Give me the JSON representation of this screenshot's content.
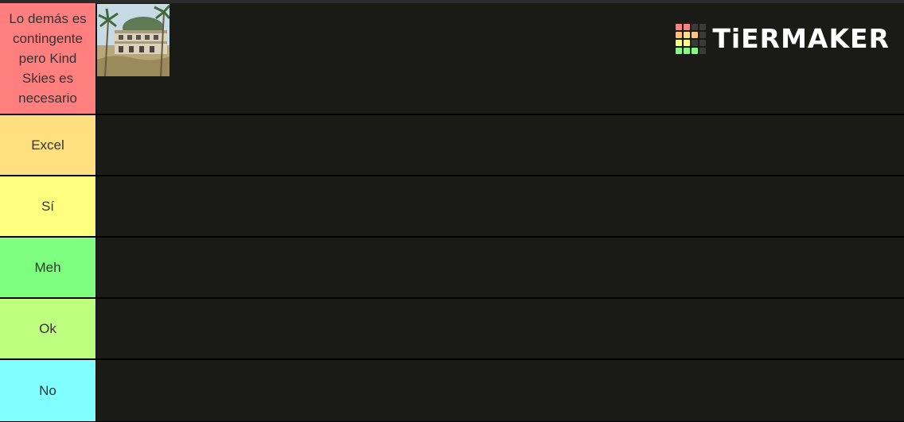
{
  "brand": {
    "name": "TiERMAKER",
    "grid_colors": [
      "#ff7f7f",
      "#ff7f7f",
      "#3a3a3a",
      "#3a3a3a",
      "#ffbf7f",
      "#ffdf7f",
      "#ffbf7f",
      "#3a3a3a",
      "#ffff7f",
      "#ffff7f",
      "#3a3a3a",
      "#3a3a3a",
      "#7fff7f",
      "#7fff7f",
      "#7fff7f",
      "#3a3a3a"
    ]
  },
  "tiers": [
    {
      "label": "Lo demás es contingente pero Kind Skies es necesario",
      "color": "#ff7f7f"
    },
    {
      "label": "Excel",
      "color": "#ffdf7f"
    },
    {
      "label": "Sí",
      "color": "#ffff7f"
    },
    {
      "label": "Meh",
      "color": "#7fff7f"
    },
    {
      "label": "Ok",
      "color": "#bfff7f"
    },
    {
      "label": "No",
      "color": "#7fffff"
    }
  ],
  "items": {
    "tier_0": [
      {
        "icon": "abandoned-building-thumbnail"
      }
    ]
  }
}
